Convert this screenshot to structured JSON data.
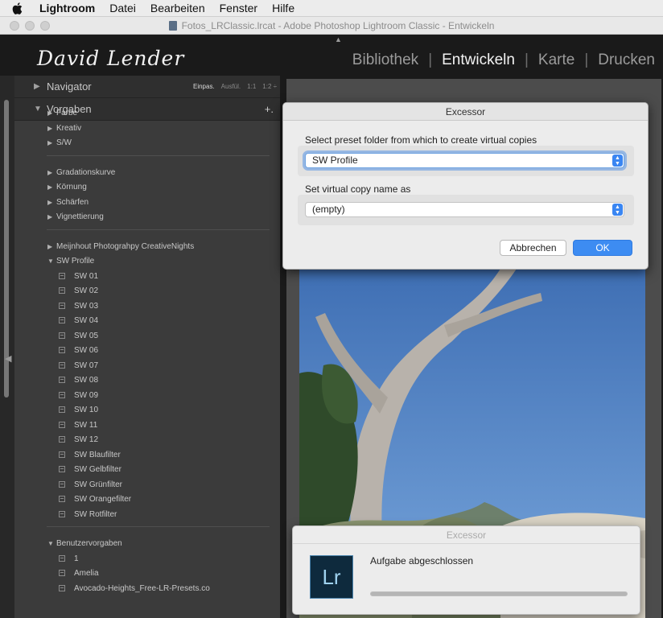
{
  "menubar": {
    "app": "Lightroom",
    "items": [
      "Datei",
      "Bearbeiten",
      "Fenster",
      "Hilfe"
    ]
  },
  "window": {
    "title": "Fotos_LRClassic.lrcat - Adobe Photoshop Lightroom Classic - Entwickeln"
  },
  "identity_plate": "David Lender",
  "modules": [
    {
      "label": "Bibliothek",
      "active": false
    },
    {
      "label": "Entwickeln",
      "active": true
    },
    {
      "label": "Karte",
      "active": false
    },
    {
      "label": "Drucken",
      "active": false
    }
  ],
  "navigator": {
    "label": "Navigator",
    "options": [
      "Einpas.",
      "Ausfül.",
      "1:1",
      "1:2 ÷"
    ]
  },
  "presets_panel": {
    "label": "Vorgaben",
    "add_icon": "+.",
    "groups": [
      {
        "name": "Farbe"
      },
      {
        "name": "Kreativ"
      },
      {
        "name": "S/W"
      }
    ],
    "groups2": [
      {
        "name": "Gradationskurve"
      },
      {
        "name": "Körnung"
      },
      {
        "name": "Schärfen"
      },
      {
        "name": "Vignettierung"
      }
    ],
    "meijnhout": "Meijnhout Photograhpy CreativeNights",
    "sw_profile": "SW Profile",
    "sw_items": [
      "SW 01",
      "SW 02",
      "SW 03",
      "SW 04",
      "SW 05",
      "SW 06",
      "SW 07",
      "SW 08",
      "SW 09",
      "SW 10",
      "SW 11",
      "SW 12",
      "SW Blaufilter",
      "SW Gelbfilter",
      "SW Grünfilter",
      "SW Orangefilter",
      "SW Rotfilter"
    ],
    "user_presets": "Benutzervorgaben",
    "user_items": [
      "1",
      "Amelia",
      "Avocado-Heights_Free-LR-Presets.co"
    ]
  },
  "dialog": {
    "title": "Excessor",
    "folder_label": "Select preset folder from which to create virtual copies",
    "folder_value": "SW Profile",
    "name_label": "Set virtual copy name as",
    "name_value": "(empty)",
    "cancel": "Abbrechen",
    "ok": "OK"
  },
  "notification": {
    "title": "Excessor",
    "logo": "Lr",
    "message": "Aufgabe abgeschlossen",
    "progress": 1.0
  },
  "icons": {
    "apple": "apple-icon",
    "disclosure": "triangle-icon",
    "preset": "preset-icon",
    "popup": "popup-arrows-icon"
  }
}
